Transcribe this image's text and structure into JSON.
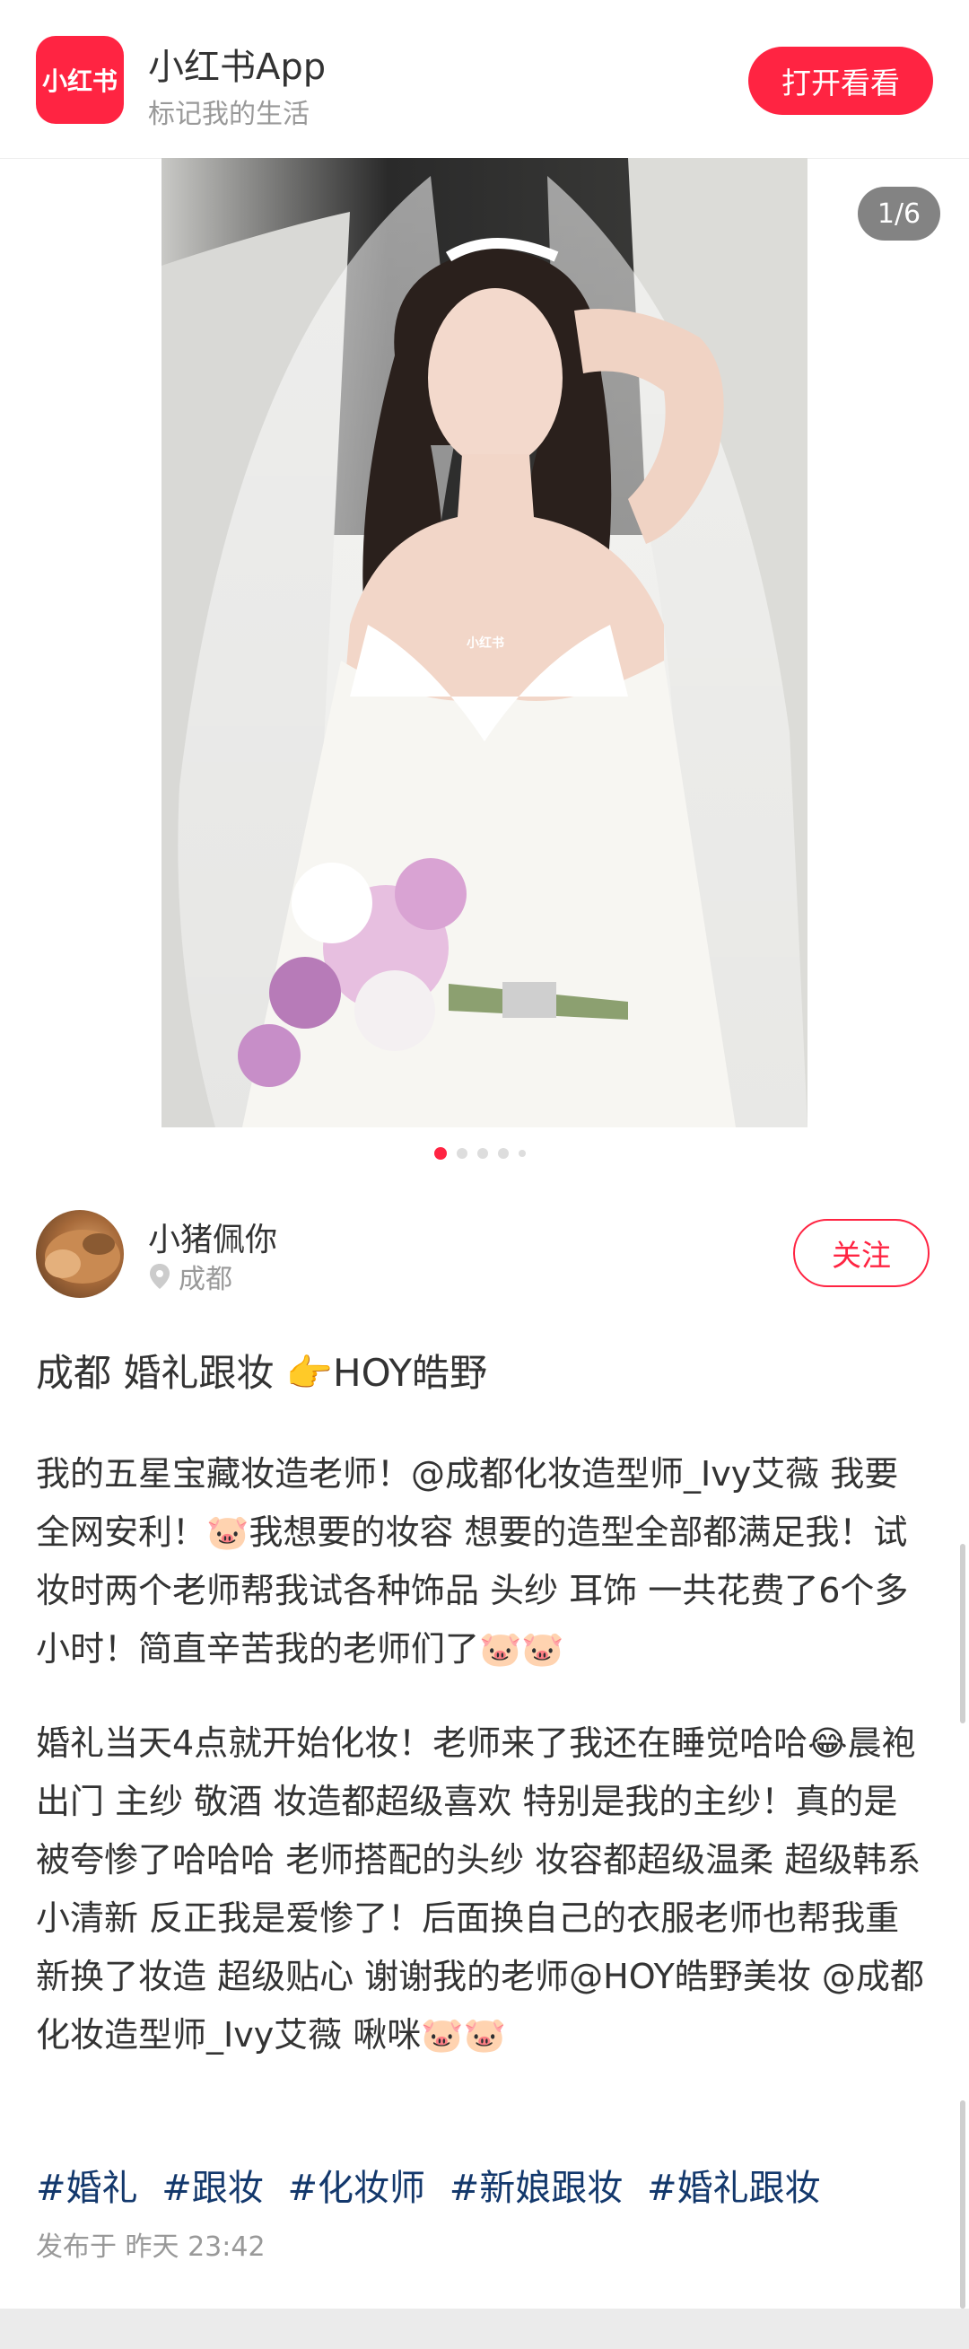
{
  "banner": {
    "logo_text": "小红书",
    "app_name": "小红书App",
    "slogan": "标记我的生活",
    "open_button": "打开看看"
  },
  "photo": {
    "counter": "1/6",
    "watermark": "小红书",
    "current_index": 1,
    "total": 6
  },
  "author": {
    "name": "小猪佩你",
    "location": "成都",
    "follow_button": "关注"
  },
  "note": {
    "title": "成都 婚礼跟妆 👉HOY皓野",
    "paragraph1": "我的五星宝藏妆造老师！@成都化妆造型师_Ivy艾薇 我要全网安利！🐷我想要的妆容 想要的造型全部都满足我！试妆时两个老师帮我试各种饰品 头纱 耳饰 一共花费了6个多小时！简直辛苦我的老师们了🐷🐷",
    "paragraph2": "婚礼当天4点就开始化妆！老师来了我还在睡觉哈哈😂晨袍 出门 主纱 敬酒 妆造都超级喜欢 特别是我的主纱！真的是被夸惨了哈哈哈 老师搭配的头纱 妆容都超级温柔 超级韩系小清新 反正我是爱惨了！后面换自己的衣服老师也帮我重新换了妆造 超级贴心 谢谢我的老师@HOY皓野美妆 @成都化妆造型师_Ivy艾薇 啾咪🐷🐷",
    "tags": [
      "#婚礼",
      "#跟妆",
      "#化妆师",
      "#新娘跟妆",
      "#婚礼跟妆"
    ],
    "published": "发布于 昨天 23:42"
  },
  "colors": {
    "brand": "#ff2442",
    "tag": "#13386c",
    "muted": "#999999"
  },
  "icons": [
    "location-pin-icon"
  ]
}
